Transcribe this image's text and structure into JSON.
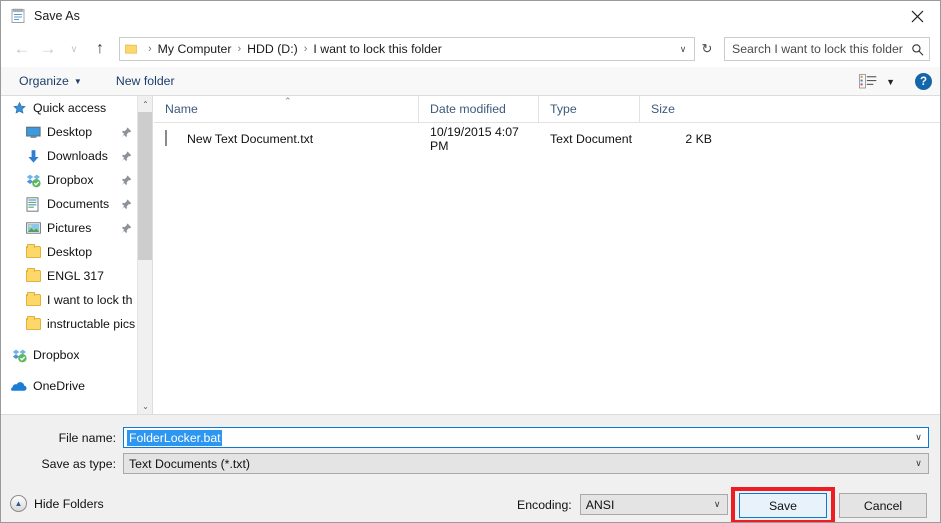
{
  "window": {
    "title": "Save As",
    "icon": "notepad-icon",
    "close_label": "✕"
  },
  "address_bar": {
    "back_label": "←",
    "forward_label": "→",
    "recent_label": "∨",
    "up_label": "↑",
    "folder_icon": "folder-icon",
    "separator": "›",
    "crumbs": [
      "My Computer",
      "HDD (D:)",
      "I want to lock this folder"
    ],
    "dropdown_caret": "∨",
    "refresh_label": "↻"
  },
  "search": {
    "placeholder": "Search I want to lock this folder",
    "value": "Search I want to lock this folder",
    "icon": "search-icon"
  },
  "command_bar": {
    "organize_label": "Organize",
    "organize_caret": "▼",
    "new_folder_label": "New folder",
    "view_icon": "view-list-icon",
    "view_caret": "▼",
    "help_label": "?"
  },
  "nav_pane": {
    "items": [
      {
        "label": "Quick access",
        "icon": "star-icon",
        "indent": 0,
        "pinned": false,
        "gap": false
      },
      {
        "label": "Desktop",
        "icon": "monitor-icon",
        "indent": 1,
        "pinned": true,
        "gap": false
      },
      {
        "label": "Downloads",
        "icon": "download-icon",
        "indent": 1,
        "pinned": true,
        "gap": false
      },
      {
        "label": "Dropbox",
        "icon": "dropbox-icon",
        "indent": 1,
        "pinned": true,
        "gap": false
      },
      {
        "label": "Documents",
        "icon": "documents-icon",
        "indent": 1,
        "pinned": true,
        "gap": false
      },
      {
        "label": "Pictures",
        "icon": "pictures-icon",
        "indent": 1,
        "pinned": true,
        "gap": false
      },
      {
        "label": "Desktop",
        "icon": "folder-icon",
        "indent": 1,
        "pinned": false,
        "gap": false
      },
      {
        "label": "ENGL 317",
        "icon": "folder-icon",
        "indent": 1,
        "pinned": false,
        "gap": false
      },
      {
        "label": "I want to lock th",
        "icon": "folder-icon",
        "indent": 1,
        "pinned": false,
        "gap": false
      },
      {
        "label": "instructable pics",
        "icon": "folder-icon",
        "indent": 1,
        "pinned": false,
        "gap": false
      },
      {
        "label": "Dropbox",
        "icon": "dropbox-icon",
        "indent": 0,
        "pinned": false,
        "gap": true
      },
      {
        "label": "OneDrive",
        "icon": "onedrive-icon",
        "indent": 0,
        "pinned": false,
        "gap": true
      }
    ],
    "scrollbar": {
      "up_arrow": "⌃",
      "down_arrow": "⌄"
    }
  },
  "file_list": {
    "columns": [
      "Name",
      "Date modified",
      "Type",
      "Size"
    ],
    "sort_caret": "⌃",
    "rows": [
      {
        "name": "New Text Document.txt",
        "date_modified": "10/19/2015 4:07 PM",
        "type": "Text Document",
        "size": "2 KB",
        "icon": "text-document-icon"
      }
    ]
  },
  "bottom": {
    "file_name_label": "File name:",
    "file_name_value": "FolderLocker.bat",
    "save_as_type_label": "Save as type:",
    "save_as_type_value": "Text Documents (*.txt)",
    "dropdown_caret": "∨",
    "hide_folders_label": "Hide Folders",
    "hide_folders_icon": "▲",
    "encoding_label": "Encoding:",
    "encoding_value": "ANSI",
    "save_label": "Save",
    "cancel_label": "Cancel"
  },
  "colors": {
    "accent_blue": "#0a7bd4",
    "selection_blue": "#2d96f0",
    "highlight_red": "#ee1d24",
    "link_blue": "#1b3f6b",
    "header_text": "#3b5a7d",
    "panel_gray": "#f0f0f0"
  }
}
